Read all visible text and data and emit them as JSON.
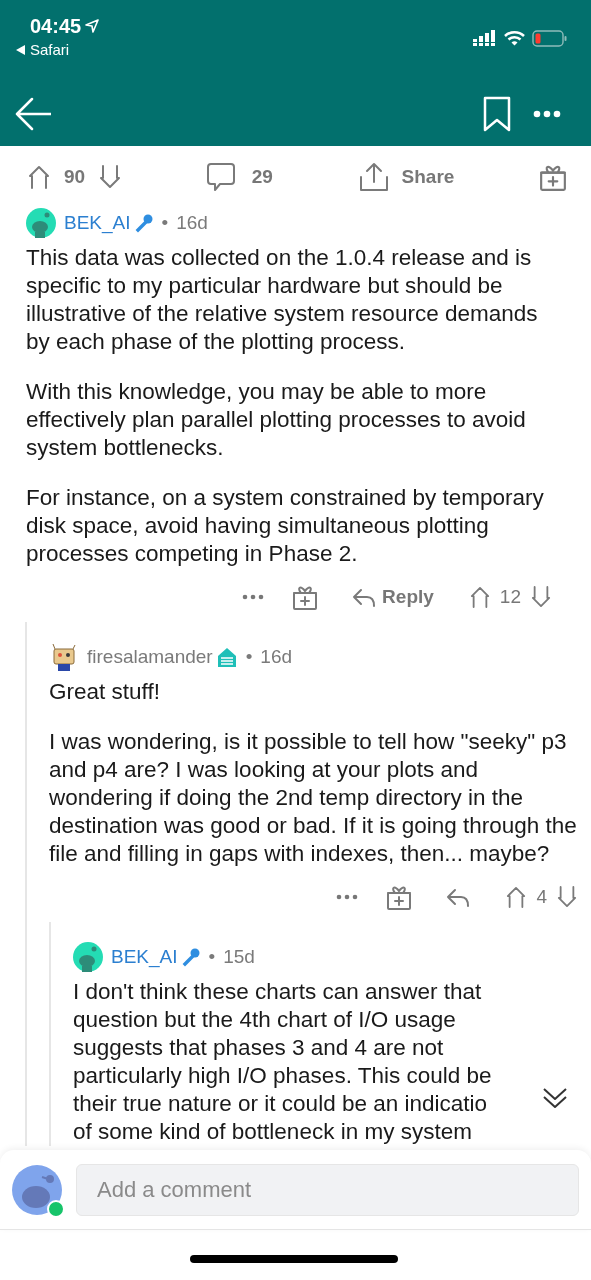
{
  "status_bar": {
    "time": "04:45",
    "back_app": "Safari"
  },
  "post_actions": {
    "votes": "90",
    "comments": "29",
    "share": "Share"
  },
  "comments": [
    {
      "kind": "snoo",
      "author": "BEK_AI",
      "separator": "•",
      "age": "16d",
      "paragraphs": [
        "This data was collected on the 1.0.4 release and is specific to my particular hardware but should be illustrative of the relative system resource demands by each phase of the plotting process.",
        "With this knowledge, you may be able to more effectively plan parallel plotting processes to avoid system bottlenecks.",
        "For instance, on a system constrained by temporary disk space, avoid having simultaneous plotting processes competing in Phase 2."
      ],
      "reply_label": "Reply",
      "votes": "12",
      "children": [
        {
          "kind": "robot",
          "author": "firesalamander",
          "separator": "•",
          "age": "16d",
          "paragraphs": [
            "Great stuff!",
            "I was wondering, is it possible to tell how \"seeky\" p3 and p4 are? I was looking at your plots and wondering if doing the 2nd temp directory in the destination was good or bad. If it is going through the file and filling in gaps with indexes, then... maybe?"
          ],
          "votes": "4",
          "children": [
            {
              "kind": "snoo",
              "author": "BEK_AI",
              "separator": "•",
              "age": "15d",
              "paragraphs": [
                "I don't think these charts can answer that question but the 4th chart of I/O usage suggests that phases 3 and 4 are not particularly high I/O phases. This could be their true nature or it could be an indicatio"
              ],
              "cut_line": "of some kind of bottleneck in my system"
            }
          ]
        }
      ]
    }
  ],
  "composer": {
    "placeholder": "Add a comment",
    "online": true
  }
}
